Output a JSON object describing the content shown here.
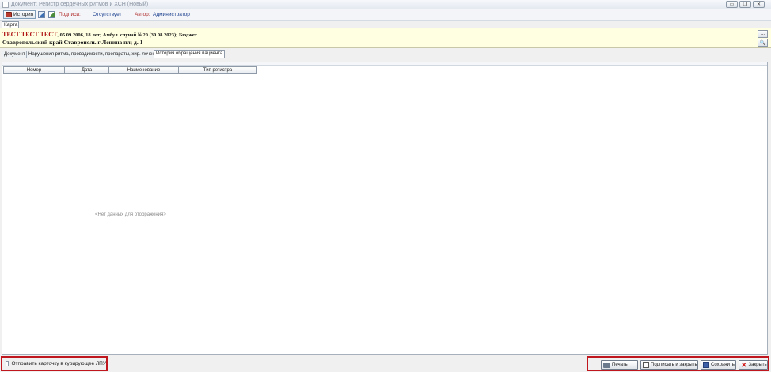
{
  "window": {
    "title": "Документ: Регистр сердечных ритмов и ХСН (Новый)",
    "buttons": [
      "▭",
      "❐",
      "✕"
    ]
  },
  "toolbar": {
    "history_label": "История",
    "sign_label": "Подписи:",
    "sign_status": "Отсутствует",
    "author_label": "Автор:",
    "author_value": "Администратор"
  },
  "card_tab": "Карта",
  "patient": {
    "name": "ТЕСТ ТЕСТ ТЕСТ",
    "meta": ", 05.09.2006, 18 лет; Амбул. случай №20 (30.08.2023); Бюджет",
    "address": "Ставропольский край Ставрополь г Ленина пл; д. 1",
    "more_button": "...",
    "search_button": "🔍"
  },
  "tabs": [
    {
      "label": "Документ"
    },
    {
      "label": "Нарушения ритма, проводимости, препараты, хир. лечение"
    },
    {
      "label": "История обращения пациента"
    }
  ],
  "grid": {
    "columns": [
      "Номер",
      "Дата",
      "Наименование",
      "Тип регистра"
    ],
    "empty_text": "<Нет данных для отображения>"
  },
  "footer": {
    "checkbox_label": "Отправить карточку в курирующее ЛПУ",
    "print_label": "Печать",
    "sign_close_label": "Подписать и закрыть",
    "save_label": "Сохранить",
    "close_label": "Закрыть"
  }
}
